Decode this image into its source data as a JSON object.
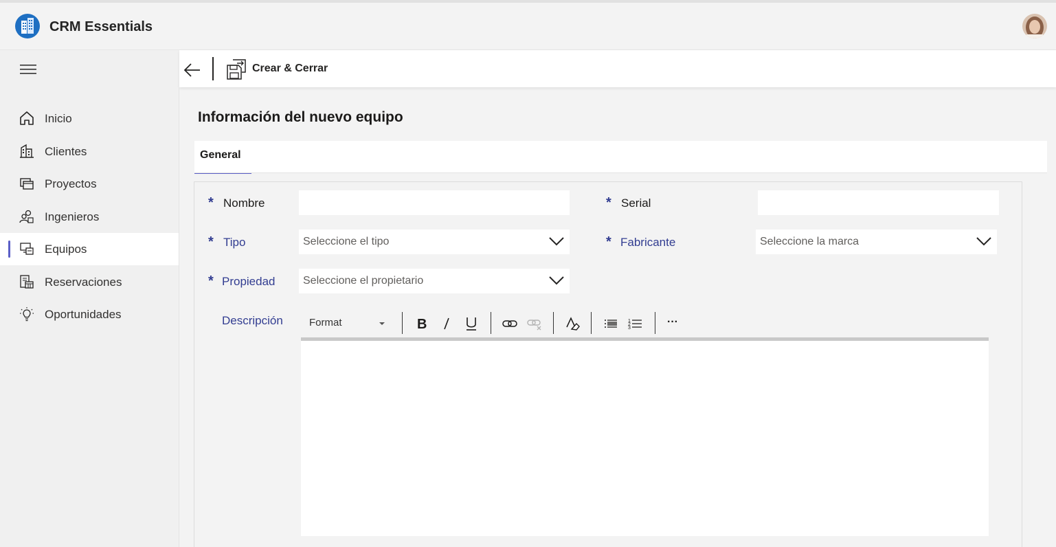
{
  "app": {
    "title": "CRM Essentials"
  },
  "commandbar": {
    "save_close_label": "Crear & Cerrar"
  },
  "sidebar": {
    "items": [
      {
        "label": "Inicio",
        "icon": "home-icon",
        "active": false
      },
      {
        "label": "Clientes",
        "icon": "building-icon",
        "active": false
      },
      {
        "label": "Proyectos",
        "icon": "folders-icon",
        "active": false
      },
      {
        "label": "Ingenieros",
        "icon": "people-icon",
        "active": false
      },
      {
        "label": "Equipos",
        "icon": "devices-icon",
        "active": true
      },
      {
        "label": "Reservaciones",
        "icon": "calendar-doc-icon",
        "active": false
      },
      {
        "label": "Oportunidades",
        "icon": "lightbulb-icon",
        "active": false
      }
    ]
  },
  "page": {
    "title": "Información del nuevo equipo"
  },
  "tabs": [
    {
      "label": "General",
      "active": true
    }
  ],
  "form": {
    "required_mark": "*",
    "nombre": {
      "label": "Nombre",
      "value": ""
    },
    "serial": {
      "label": "Serial",
      "value": ""
    },
    "tipo": {
      "label": "Tipo",
      "placeholder": "Seleccione el tipo"
    },
    "fabricante": {
      "label": "Fabricante",
      "placeholder": "Seleccione la marca"
    },
    "propiedad": {
      "label": "Propiedad",
      "placeholder": "Seleccione el propietario"
    },
    "descripcion": {
      "label": "Descripción",
      "toolbar": {
        "format_label": "Format",
        "more_label": "···"
      }
    }
  },
  "colors": {
    "accent": "#5b5fc7",
    "label_blue": "#323d91",
    "background": "#f3f3f3"
  }
}
